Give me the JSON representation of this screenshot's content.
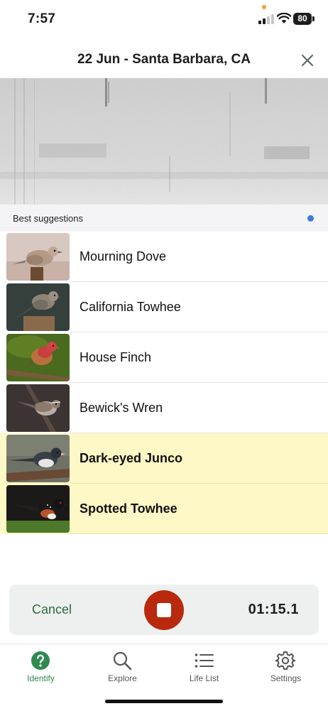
{
  "status_bar": {
    "time": "7:57",
    "battery": "80"
  },
  "header": {
    "title": "22 Jun - Santa Barbara, CA"
  },
  "suggestions": {
    "label": "Best suggestions",
    "birds": [
      {
        "name": "Mourning Dove",
        "highlighted": false,
        "icon": "mourning-dove-photo"
      },
      {
        "name": "California Towhee",
        "highlighted": false,
        "icon": "california-towhee-photo"
      },
      {
        "name": "House Finch",
        "highlighted": false,
        "icon": "house-finch-photo"
      },
      {
        "name": "Bewick's Wren",
        "highlighted": false,
        "icon": "bewicks-wren-photo"
      },
      {
        "name": "Dark-eyed Junco",
        "highlighted": true,
        "icon": "dark-eyed-junco-photo"
      },
      {
        "name": "Spotted Towhee",
        "highlighted": true,
        "icon": "spotted-towhee-photo"
      }
    ]
  },
  "recorder": {
    "cancel_label": "Cancel",
    "timer": "01:15.1"
  },
  "tabs": [
    {
      "label": "Identify",
      "icon": "question-circle-icon",
      "active": true
    },
    {
      "label": "Explore",
      "icon": "search-icon",
      "active": false
    },
    {
      "label": "Life List",
      "icon": "list-icon",
      "active": false
    },
    {
      "label": "Settings",
      "icon": "gear-icon",
      "active": false
    }
  ],
  "colors": {
    "accent_green": "#2e8a4e",
    "stop_red": "#b8290e",
    "highlight_yellow": "#fdf8c5",
    "dot_blue": "#3a7bd5"
  }
}
